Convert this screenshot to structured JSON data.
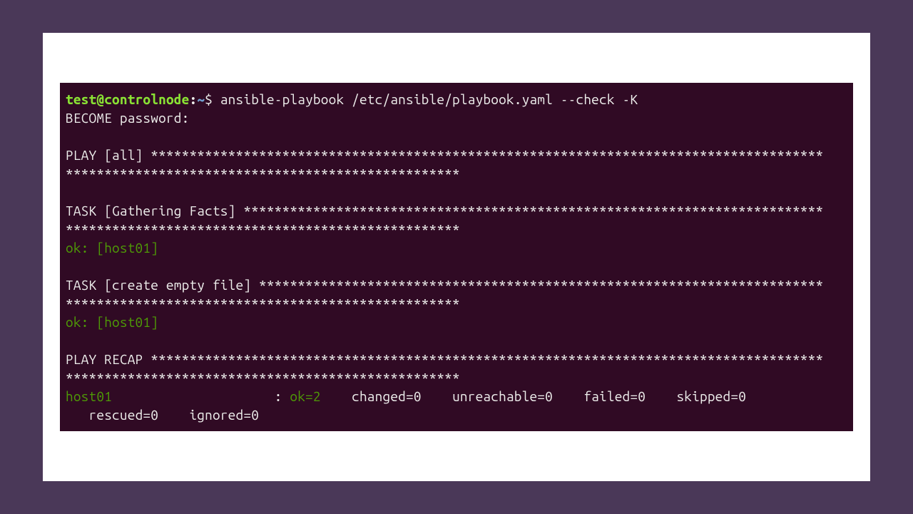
{
  "prompt": {
    "user": "test",
    "at": "@",
    "host": "controlnode",
    "colon": ":",
    "path": "~",
    "sigil": "$ ",
    "command": "ansible-playbook /etc/ansible/playbook.yaml --check -K"
  },
  "become_line": "BECOME password:",
  "play_header_1": "PLAY [all] ***************************************************************************************",
  "play_header_2": "***************************************************",
  "task1_header_1": "TASK [Gathering Facts] ***************************************************************************",
  "task1_header_2": "***************************************************",
  "task1_result": "ok: [host01]",
  "task2_header_1": "TASK [create empty file] *************************************************************************",
  "task2_header_2": "***************************************************",
  "task2_result": "ok: [host01]",
  "recap_header_1": "PLAY RECAP ***************************************************************************************",
  "recap_header_2": "***************************************************",
  "recap": {
    "host": "host01",
    "pad1": "                     : ",
    "ok": "ok=2",
    "pad2": "    ",
    "changed": "changed=0",
    "pad3": "    ",
    "unreachable": "unreachable=0",
    "pad4": "    ",
    "failed": "failed=0",
    "pad5": "    ",
    "skipped": "skipped=0",
    "line2_indent": "   ",
    "rescued": "rescued=0",
    "pad6": "    ",
    "ignored": "ignored=0"
  }
}
